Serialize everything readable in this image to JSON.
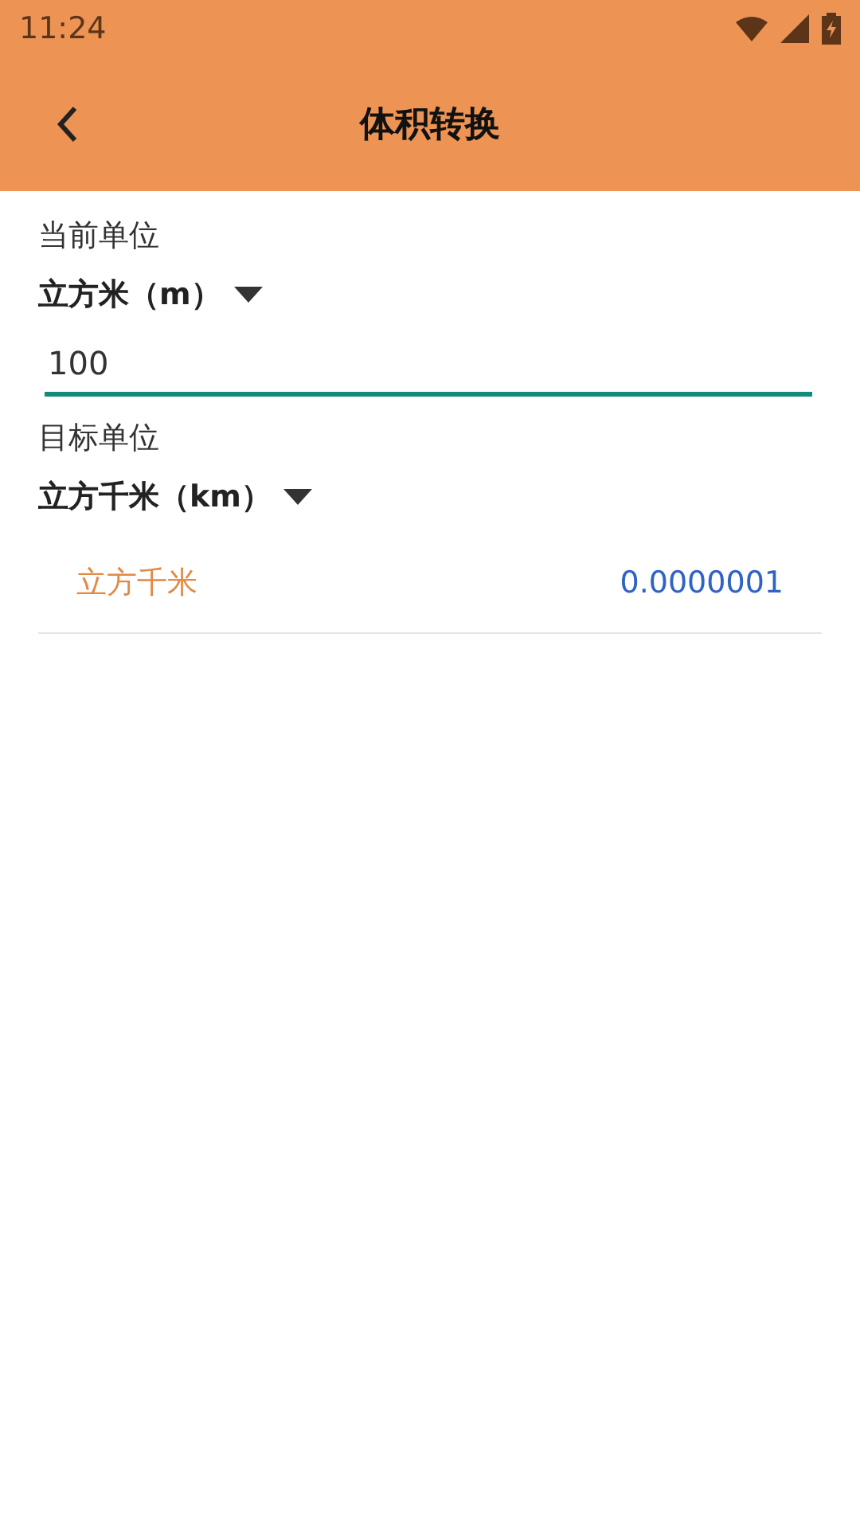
{
  "status_bar": {
    "time": "11:24"
  },
  "app_bar": {
    "title": "体积转换"
  },
  "current_unit": {
    "label": "当前单位",
    "selection": "立方米（m）"
  },
  "input": {
    "value": "100"
  },
  "target_unit": {
    "label": "目标单位",
    "selection": "立方千米（km）"
  },
  "results": [
    {
      "unit": "立方千米",
      "value": "0.0000001"
    }
  ]
}
